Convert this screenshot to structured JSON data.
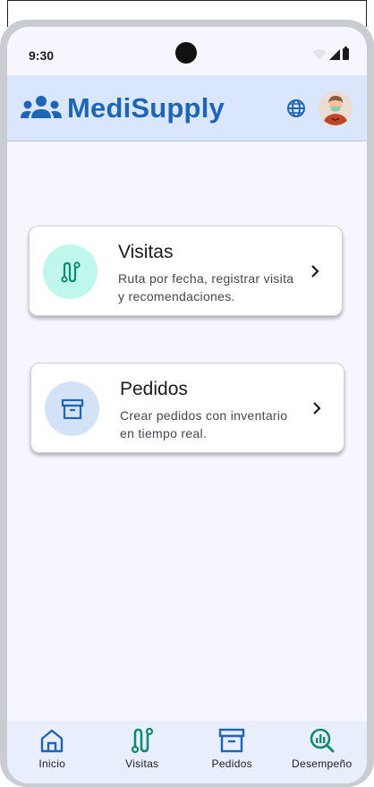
{
  "status_bar": {
    "time": "9:30"
  },
  "app_bar": {
    "title": "MediSupply"
  },
  "cards": [
    {
      "title": "Visitas",
      "description": "Ruta por fecha, registrar visita y recomendaciones."
    },
    {
      "title": "Pedidos",
      "description": "Crear pedidos con inventario en tiempo real."
    }
  ],
  "bottom_nav": {
    "items": [
      {
        "label": "Inicio",
        "icon": "home-icon"
      },
      {
        "label": "Visitas",
        "icon": "route-icon"
      },
      {
        "label": "Pedidos",
        "icon": "archive-icon"
      },
      {
        "label": "Desempeño",
        "icon": "analytics-search-icon"
      }
    ]
  },
  "colors": {
    "primary": "#1f65b5",
    "teal": "#0e8a73",
    "app_bar_bg": "#d9e6fb",
    "screen_bg": "#f7f6ff"
  }
}
